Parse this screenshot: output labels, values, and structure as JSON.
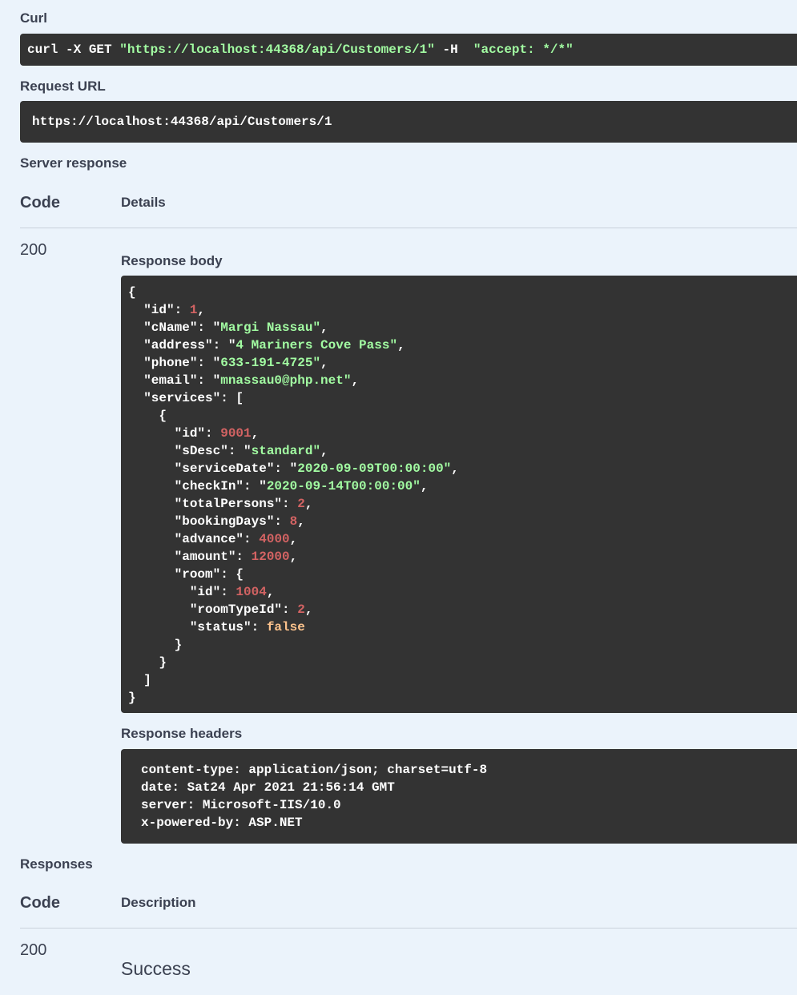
{
  "curl": {
    "label": "Curl",
    "prefix": "curl -X GET ",
    "url": "\"https://localhost:44368/api/Customers/1\"",
    "flag": " -H  ",
    "header": "\"accept: */*\""
  },
  "request_url": {
    "label": "Request URL",
    "value": "https://localhost:44368/api/Customers/1"
  },
  "server_response": {
    "label": "Server response",
    "col_code": "Code",
    "col_details": "Details",
    "code": "200",
    "body_label": "Response body",
    "body": {
      "id": 1,
      "cName": "Margi Nassau",
      "address": "4 Mariners Cove Pass",
      "phone": "633-191-4725",
      "email": "mnassau0@php.net",
      "service": {
        "id": 9001,
        "sDesc": "standard",
        "serviceDate": "2020-09-09T00:00:00",
        "checkIn": "2020-09-14T00:00:00",
        "totalPersons": 2,
        "bookingDays": 8,
        "advance": 4000,
        "amount": 12000,
        "room": {
          "id": 1004,
          "roomTypeId": 2,
          "status": "false"
        }
      }
    },
    "headers_label": "Response headers",
    "headers": [
      "content-type: application/json; charset=utf-8",
      "date: Sat24 Apr 2021 21:56:14 GMT",
      "server: Microsoft-IIS/10.0",
      "x-powered-by: ASP.NET"
    ]
  },
  "responses": {
    "label": "Responses",
    "col_code": "Code",
    "col_description": "Description",
    "code": "200",
    "description": "Success"
  }
}
